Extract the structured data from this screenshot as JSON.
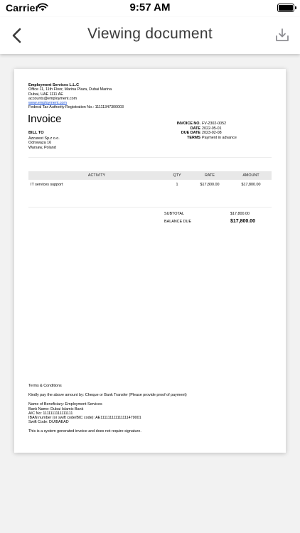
{
  "status_bar": {
    "carrier": "Carrier",
    "time": "9:57 AM"
  },
  "nav": {
    "title": "Viewing document",
    "back_icon": "chevron-left-icon",
    "download_icon": "download-icon",
    "tint": "#8e8e93"
  },
  "document": {
    "company": {
      "name": "Employment Services L.L.C",
      "address1": "Office 11, 11th Floor, Marina Plaza, Dubai Marina",
      "address2": "Dubai, UAE 1111 AE",
      "email": "accounts@employment.com",
      "website": "www.employment.com",
      "tax_reg": "Federal Tax Authority Registration No.: 11111347300003"
    },
    "title": "Invoice",
    "bill_to": {
      "label": "BILL TO",
      "name": "Azzurest Sp.z o.o.",
      "street": "Odrowaza 16",
      "city": "Warsaw, Poland"
    },
    "meta": [
      {
        "label": "INVOICE NO.",
        "value": "FV-2302-0052"
      },
      {
        "label": "DATE",
        "value": "2022-05-01"
      },
      {
        "label": "DUE DATE",
        "value": "2023-02-08"
      },
      {
        "label": "TERMS",
        "value": "Payment in advance"
      }
    ],
    "table": {
      "headers": {
        "activity": "ACTIVITY",
        "qty": "QTY",
        "rate": "RATE",
        "amount": "AMOUNT"
      },
      "rows": [
        {
          "activity": "IT services support",
          "qty": "1",
          "rate": "$17,800.00",
          "amount": "$17,800.00"
        }
      ]
    },
    "totals": {
      "subtotal_label": "SUBTOTAL",
      "subtotal_value": "$17,800.00",
      "balance_label": "BALANCE DUE",
      "balance_value": "$17,800.00"
    },
    "terms": {
      "heading": "Terms & Conditions",
      "payment_note": "Kindly pay the above amount by: Cheque or Bank Transfer (Please provide proof of payment)",
      "beneficiary": "Name of Beneficiary: Employment Services",
      "bank": "Bank Name: Dubai Islamic Bank",
      "account": "A/C No: 1111111111111111",
      "iban": "IBAN number (or swift code/BIC code): AE111111111111111479001",
      "swift": "Swift Code: DUIBAEAD",
      "footer": "This is a system generated invoice and does not require signature."
    }
  }
}
